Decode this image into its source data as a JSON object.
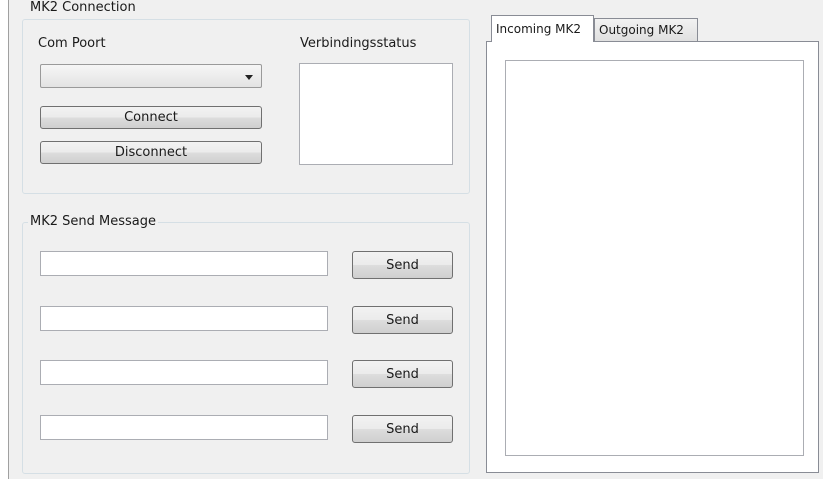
{
  "connection": {
    "title": "MK2 Connection",
    "com_port_label": "Com Poort",
    "com_port_value": "",
    "status_label": "Verbindingsstatus",
    "status_text": "",
    "connect_label": "Connect",
    "disconnect_label": "Disconnect"
  },
  "send": {
    "title": "MK2 Send Message",
    "rows": [
      {
        "value": "",
        "button": "Send"
      },
      {
        "value": "",
        "button": "Send"
      },
      {
        "value": "",
        "button": "Send"
      },
      {
        "value": "",
        "button": "Send"
      }
    ]
  },
  "tabs": [
    {
      "label": "Incoming MK2",
      "active": true
    },
    {
      "label": "Outgoing MK2",
      "active": false
    }
  ],
  "log_text": ""
}
